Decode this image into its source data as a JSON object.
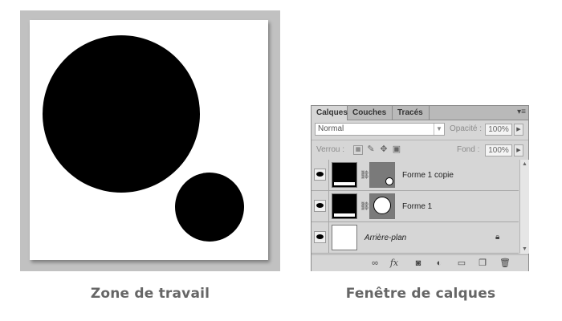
{
  "captions": {
    "work_area": "Zone de travail",
    "layers_window": "Fenêtre de calques"
  },
  "panel": {
    "tabs": [
      "Calques",
      "Couches",
      "Tracés"
    ],
    "menu_icon": "panel-menu-icon",
    "blend_mode": "Normal",
    "opacity_label": "Opacité :",
    "opacity_value": "100%",
    "lock_label": "Verrou :",
    "fill_label": "Fond :",
    "fill_value": "100%",
    "layers": [
      {
        "name": "Forme 1 copie",
        "visible": true
      },
      {
        "name": "Forme 1",
        "visible": true
      },
      {
        "name": "Arrière-plan",
        "visible": true,
        "locked": true
      }
    ]
  },
  "colors": {
    "panel_bg": "#d6d6d6",
    "caption": "#666666",
    "frame": "#c1c1c1"
  }
}
